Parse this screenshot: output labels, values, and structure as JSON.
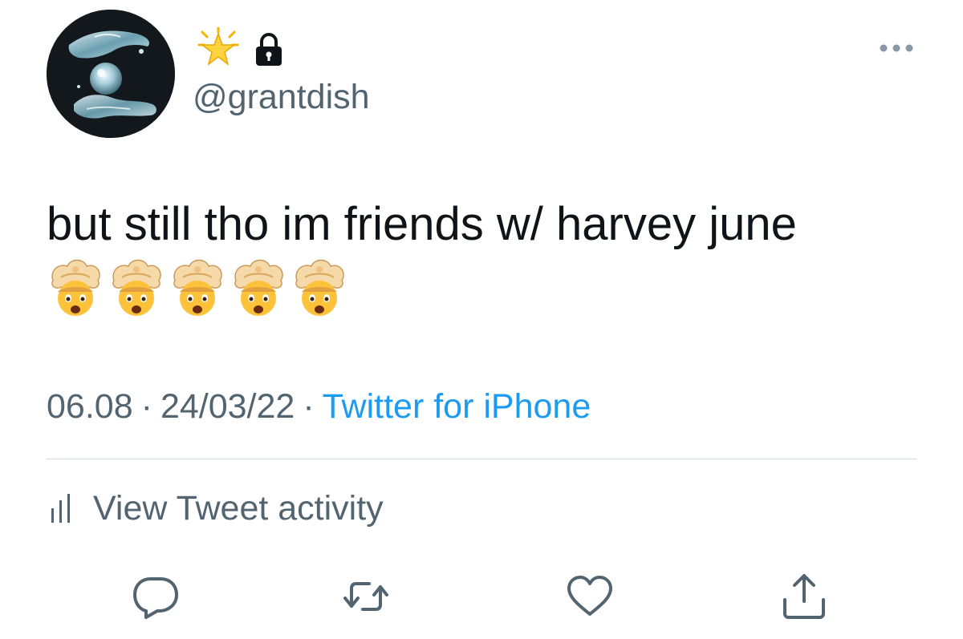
{
  "author": {
    "handle": "@grantdish",
    "badges": [
      "star-icon",
      "lock-icon"
    ]
  },
  "tweet": {
    "text": "but still tho im friends w/ harvey june",
    "emojis": [
      "🤯",
      "🤯",
      "🤯",
      "🤯",
      "🤯"
    ]
  },
  "meta": {
    "time": "06.08",
    "separator": "·",
    "date": "24/03/22",
    "source": "Twitter for iPhone"
  },
  "activity": {
    "label": "View Tweet activity",
    "icon": "bar-chart-icon"
  },
  "actions": [
    "reply-icon",
    "retweet-icon",
    "like-icon",
    "share-icon"
  ],
  "colors": {
    "text": "#0f1419",
    "secondary": "#536471",
    "link": "#1d9bf0",
    "divider": "#cfd9de",
    "background": "#ffffff"
  }
}
